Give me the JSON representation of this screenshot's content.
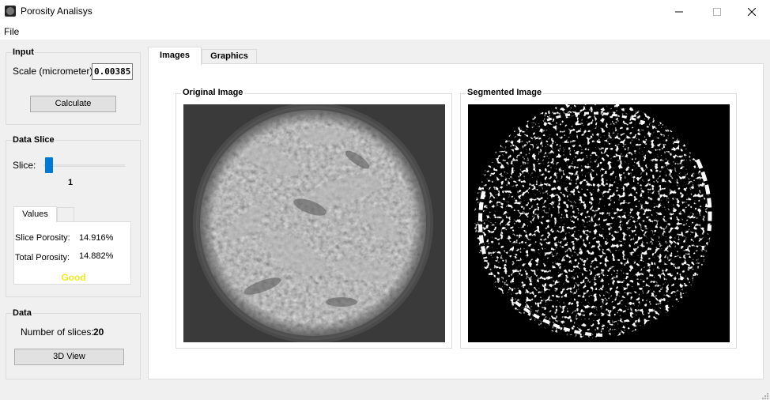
{
  "window": {
    "title": "Porosity Analisys",
    "icon": "app-disc-icon",
    "controls": [
      "minimize-icon",
      "maximize-icon",
      "close-icon"
    ]
  },
  "menu": {
    "items": [
      "File"
    ]
  },
  "input_group": {
    "title": "Input",
    "scale_label": "Scale (micrometer):",
    "scale_value": "0.00385",
    "calculate_label": "Calculate"
  },
  "slice_group": {
    "title": "Data Slice",
    "slice_label": "Slice:",
    "slice_value": "1",
    "slider_position": 0,
    "tabs": [
      "Values",
      ""
    ],
    "slice_porosity_label": "Slice Porosity:",
    "slice_porosity_value": "14.916%",
    "total_porosity_label": "Total Porosity:",
    "total_porosity_value": "14.882%",
    "status": "Good",
    "status_color": "#f2ea24"
  },
  "data_group": {
    "title": "Data",
    "slices_label": "Number of slices:",
    "slices_value": "20",
    "view3d_label": "3D View"
  },
  "main_tabs": [
    "Images",
    "Graphics"
  ],
  "images": {
    "original_title": "Original Image",
    "segmented_title": "Segmented Image"
  },
  "colors": {
    "accent": "#0078d7",
    "window_bg": "#f0f0f0",
    "panel_bg": "#ffffff"
  }
}
